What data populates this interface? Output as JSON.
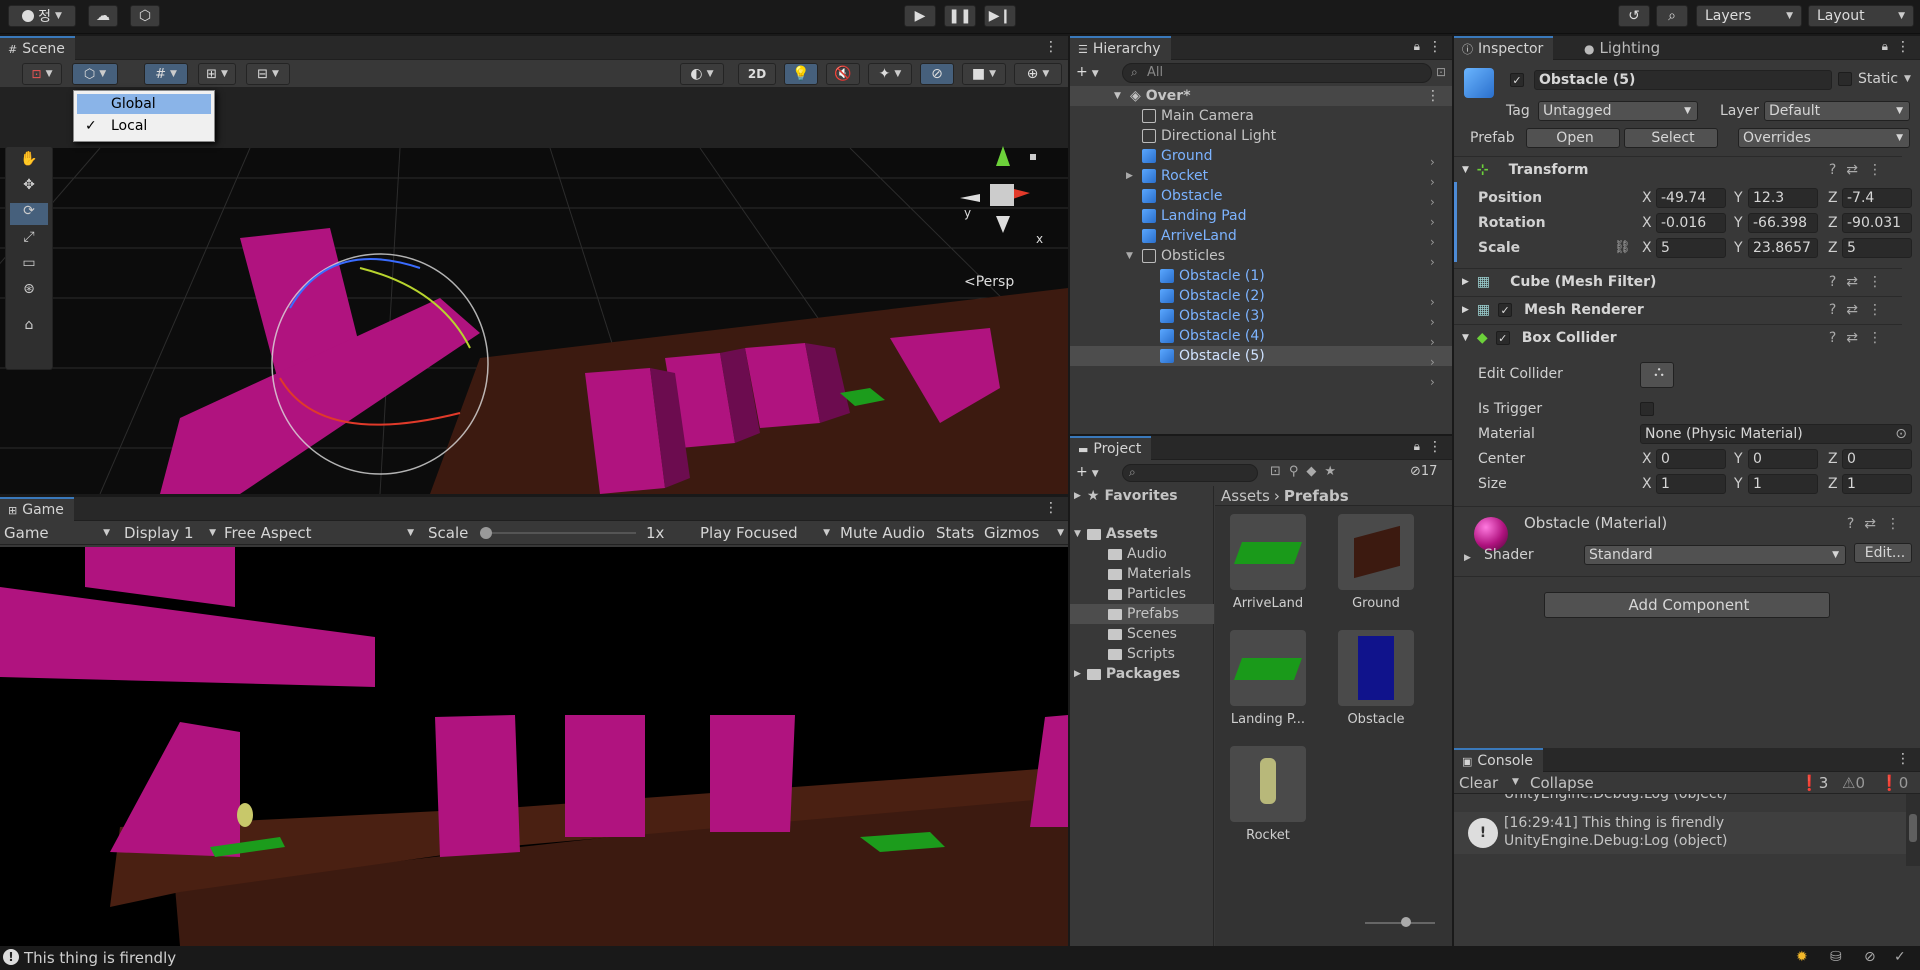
{
  "topbar": {
    "account_label": "정",
    "layers_label": "Layers",
    "layout_label": "Layout"
  },
  "scene": {
    "tab": "Scene",
    "toggle_2d": "2D",
    "persp_label": "<Persp",
    "gizmo_y": "y",
    "gizmo_x": "x",
    "dropdown": {
      "items": [
        {
          "label": "Global",
          "checked": false
        },
        {
          "label": "Local",
          "checked": true
        }
      ]
    }
  },
  "game": {
    "tab": "Game",
    "mode": "Game",
    "display": "Display 1",
    "aspect": "Free Aspect",
    "scale_label": "Scale",
    "scale_value": "1x",
    "play_focused": "Play Focused",
    "mute_audio": "Mute Audio",
    "stats": "Stats",
    "gizmos": "Gizmos"
  },
  "hierarchy": {
    "tab": "Hierarchy",
    "search_placeholder": "All",
    "items": [
      {
        "label": "Over*",
        "depth": 0,
        "scene": true,
        "expanded": true
      },
      {
        "label": "Main Camera",
        "depth": 1,
        "prefab": false
      },
      {
        "label": "Directional Light",
        "depth": 1,
        "prefab": false
      },
      {
        "label": "Ground",
        "depth": 1,
        "prefab": true,
        "arrow": true
      },
      {
        "label": "Rocket",
        "depth": 1,
        "prefab": true,
        "arrow": true,
        "foldout": true
      },
      {
        "label": "Obstacle",
        "depth": 1,
        "prefab": true,
        "arrow": true
      },
      {
        "label": "Landing Pad",
        "depth": 1,
        "prefab": true,
        "arrow": true
      },
      {
        "label": "ArriveLand",
        "depth": 1,
        "prefab": true,
        "arrow": true
      },
      {
        "label": "Obsticles",
        "depth": 1,
        "prefab": false,
        "expanded": true
      },
      {
        "label": "Obstacle (1)",
        "depth": 2,
        "prefab": true,
        "arrow": true
      },
      {
        "label": "Obstacle (2)",
        "depth": 2,
        "prefab": true,
        "arrow": true
      },
      {
        "label": "Obstacle (3)",
        "depth": 2,
        "prefab": true,
        "arrow": true
      },
      {
        "label": "Obstacle (4)",
        "depth": 2,
        "prefab": true,
        "arrow": true
      },
      {
        "label": "Obstacle (5)",
        "depth": 2,
        "prefab": true,
        "arrow": true,
        "selected": true
      }
    ]
  },
  "project": {
    "tab": "Project",
    "hidden_count": "17",
    "favorites": "Favorites",
    "assets": "Assets",
    "packages": "Packages",
    "folders": [
      "Audio",
      "Materials",
      "Particles",
      "Prefabs",
      "Scenes",
      "Scripts"
    ],
    "breadcrumb_root": "Assets",
    "breadcrumb_current": "Prefabs",
    "items": [
      {
        "label": "ArriveLand",
        "kind": "green-pad"
      },
      {
        "label": "Ground",
        "kind": "brown-box"
      },
      {
        "label": "Landing P...",
        "kind": "green-pad"
      },
      {
        "label": "Obstacle",
        "kind": "blue-box"
      },
      {
        "label": "Rocket",
        "kind": "rocket"
      }
    ]
  },
  "inspector": {
    "tab": "Inspector",
    "lighting_tab": "Lighting",
    "object_name": "Obstacle (5)",
    "static_label": "Static",
    "tag_label": "Tag",
    "tag_value": "Untagged",
    "layer_label": "Layer",
    "layer_value": "Default",
    "prefab_label": "Prefab",
    "open": "Open",
    "select": "Select",
    "overrides": "Overrides",
    "transform": {
      "title": "Transform",
      "position_label": "Position",
      "rotation_label": "Rotation",
      "scale_label": "Scale",
      "position": {
        "x": "-49.74",
        "y": "12.3",
        "z": "-7.4"
      },
      "rotation": {
        "x": "-0.016",
        "y": "-66.398",
        "z": "-90.031"
      },
      "scale": {
        "x": "5",
        "y": "23.8657",
        "z": "5"
      }
    },
    "mesh_filter": "Cube (Mesh Filter)",
    "mesh_renderer": "Mesh Renderer",
    "box_collider": {
      "title": "Box Collider",
      "edit_collider": "Edit Collider",
      "is_trigger": "Is Trigger",
      "material_label": "Material",
      "material_value": "None (Physic Material)",
      "center_label": "Center",
      "center": {
        "x": "0",
        "y": "0",
        "z": "0"
      },
      "size_label": "Size",
      "size": {
        "x": "1",
        "y": "1",
        "z": "1"
      }
    },
    "material": {
      "title": "Obstacle (Material)",
      "shader_label": "Shader",
      "shader_value": "Standard",
      "edit": "Edit..."
    },
    "add_component": "Add Component",
    "axis": {
      "x": "X",
      "y": "Y",
      "z": "Z"
    }
  },
  "console": {
    "tab": "Console",
    "clear": "Clear",
    "collapse": "Collapse",
    "counts": {
      "info": "3",
      "warn": "0",
      "error": "0"
    },
    "partial_line": "UnityEngine.Debug:Log (object)",
    "entry_line1": "[16:29:41] This thing is firendly",
    "entry_line2": "UnityEngine.Debug:Log (object)"
  },
  "statusbar": {
    "message": "This thing is firendly"
  }
}
